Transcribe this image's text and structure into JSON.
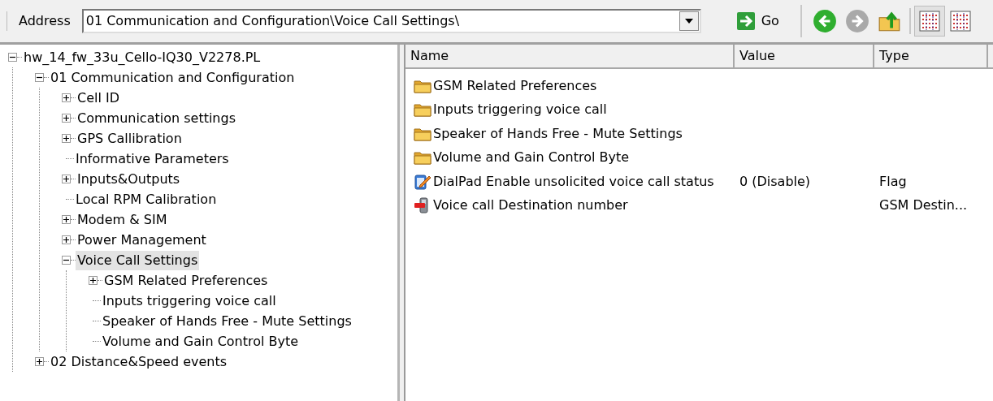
{
  "toolbar": {
    "address_label": "Address",
    "address_value": "01 Communication and Configuration\\Voice Call Settings\\",
    "go_label": "Go",
    "nav": [
      {
        "kind": "back",
        "disabled": false
      },
      {
        "kind": "forward",
        "disabled": true
      },
      {
        "kind": "up",
        "disabled": false
      }
    ],
    "views": [
      {
        "selected": true
      },
      {
        "selected": false
      }
    ]
  },
  "tree": [
    {
      "label": "hw_14_fw_33u_Cello-IQ30_V2278.PL",
      "kind": "branch",
      "expanded": true,
      "selected": false,
      "children": [
        {
          "label": "01 Communication and Configuration",
          "kind": "branch",
          "expanded": true,
          "selected": false,
          "children": [
            {
              "label": "Cell ID",
              "kind": "branch",
              "expanded": false,
              "selected": false
            },
            {
              "label": "Communication settings",
              "kind": "branch",
              "expanded": false,
              "selected": false
            },
            {
              "label": "GPS Callibration",
              "kind": "branch",
              "expanded": false,
              "selected": false
            },
            {
              "label": "Informative Parameters",
              "kind": "leaf",
              "selected": false
            },
            {
              "label": "Inputs&Outputs",
              "kind": "branch",
              "expanded": false,
              "selected": false
            },
            {
              "label": "Local RPM Calibration",
              "kind": "leaf",
              "selected": false
            },
            {
              "label": "Modem & SIM",
              "kind": "branch",
              "expanded": false,
              "selected": false
            },
            {
              "label": "Power Management",
              "kind": "branch",
              "expanded": false,
              "selected": false
            },
            {
              "label": "Voice Call Settings",
              "kind": "branch",
              "expanded": true,
              "selected": true,
              "children": [
                {
                  "label": "GSM Related Preferences",
                  "kind": "branch",
                  "expanded": false,
                  "selected": false
                },
                {
                  "label": "Inputs triggering voice call",
                  "kind": "leaf",
                  "selected": false
                },
                {
                  "label": "Speaker of Hands Free - Mute Settings",
                  "kind": "leaf",
                  "selected": false
                },
                {
                  "label": "Volume and Gain Control Byte",
                  "kind": "leaf",
                  "selected": false
                }
              ]
            }
          ]
        },
        {
          "label": "02 Distance&Speed events",
          "kind": "branch",
          "expanded": false,
          "selected": false
        }
      ]
    }
  ],
  "list": {
    "columns": [
      "Name",
      "Value",
      "Type"
    ],
    "rows": [
      {
        "kind": "folder",
        "name": "GSM Related Preferences"
      },
      {
        "kind": "folder",
        "name": "Inputs triggering voice call"
      },
      {
        "kind": "folder",
        "name": "Speaker of Hands Free - Mute Settings"
      },
      {
        "kind": "folder",
        "name": "Volume and Gain Control Byte"
      },
      {
        "kind": "flag",
        "name": "DialPad Enable unsolicited voice call status",
        "value": "0 (Disable)",
        "type": "Flag"
      },
      {
        "kind": "phone",
        "name": "Voice call  Destination number",
        "type": "GSM Destin..."
      }
    ]
  }
}
